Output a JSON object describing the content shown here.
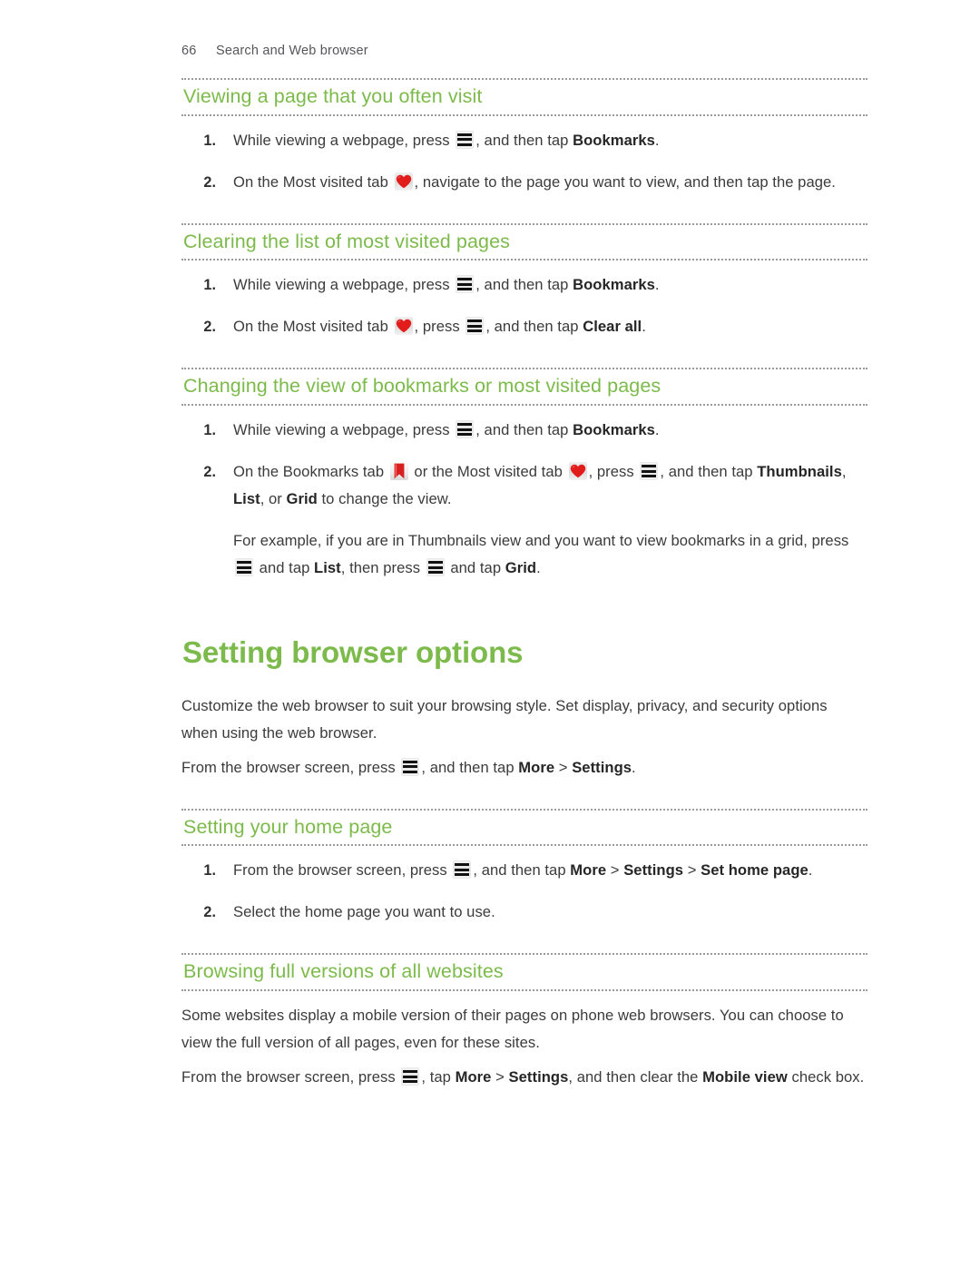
{
  "page": {
    "number": "66",
    "running_head": "Search and Web browser",
    "heading_color": "#7cbb4b",
    "body_color": "#3b3b3b"
  },
  "icons": {
    "menu": "menu-bars-icon",
    "most_visited": "heart-icon",
    "bookmarks": "bookmark-ribbon-icon"
  },
  "sections": {
    "viewing_page": {
      "heading": "Viewing a page that you often visit",
      "steps": [
        {
          "num": "1.",
          "parts": [
            {
              "t": "text",
              "v": "While viewing a webpage, press "
            },
            {
              "t": "icon",
              "v": "menu"
            },
            {
              "t": "text",
              "v": ", and then tap "
            },
            {
              "t": "bold",
              "v": "Bookmarks"
            },
            {
              "t": "text",
              "v": "."
            }
          ]
        },
        {
          "num": "2.",
          "parts": [
            {
              "t": "text",
              "v": "On the Most visited tab "
            },
            {
              "t": "icon",
              "v": "most_visited"
            },
            {
              "t": "text",
              "v": ", navigate to the page you want to view, and then tap the page."
            }
          ]
        }
      ]
    },
    "clearing_list": {
      "heading": "Clearing the list of most visited pages",
      "steps": [
        {
          "num": "1.",
          "parts": [
            {
              "t": "text",
              "v": "While viewing a webpage, press "
            },
            {
              "t": "icon",
              "v": "menu"
            },
            {
              "t": "text",
              "v": ", and then tap "
            },
            {
              "t": "bold",
              "v": "Bookmarks"
            },
            {
              "t": "text",
              "v": "."
            }
          ]
        },
        {
          "num": "2.",
          "parts": [
            {
              "t": "text",
              "v": "On the Most visited tab "
            },
            {
              "t": "icon",
              "v": "most_visited"
            },
            {
              "t": "text",
              "v": ", press "
            },
            {
              "t": "icon",
              "v": "menu"
            },
            {
              "t": "text",
              "v": ", and then tap "
            },
            {
              "t": "bold",
              "v": "Clear all"
            },
            {
              "t": "text",
              "v": "."
            }
          ]
        }
      ]
    },
    "changing_view": {
      "heading": "Changing the view of bookmarks or most visited pages",
      "steps": [
        {
          "num": "1.",
          "parts": [
            {
              "t": "text",
              "v": "While viewing a webpage, press "
            },
            {
              "t": "icon",
              "v": "menu"
            },
            {
              "t": "text",
              "v": ", and then tap "
            },
            {
              "t": "bold",
              "v": "Bookmarks"
            },
            {
              "t": "text",
              "v": "."
            }
          ]
        },
        {
          "num": "2.",
          "parts": [
            {
              "t": "text",
              "v": "On the Bookmarks tab "
            },
            {
              "t": "icon",
              "v": "bookmarks"
            },
            {
              "t": "text",
              "v": " or the Most visited tab "
            },
            {
              "t": "icon",
              "v": "most_visited"
            },
            {
              "t": "text",
              "v": ", press "
            },
            {
              "t": "icon",
              "v": "menu"
            },
            {
              "t": "text",
              "v": ", and then tap "
            },
            {
              "t": "bold",
              "v": "Thumbnails"
            },
            {
              "t": "text",
              "v": ", "
            },
            {
              "t": "bold",
              "v": "List"
            },
            {
              "t": "text",
              "v": ", or "
            },
            {
              "t": "bold",
              "v": "Grid"
            },
            {
              "t": "text",
              "v": " to change the view."
            }
          ],
          "sub_parts": [
            {
              "t": "text",
              "v": "For example, if you are in Thumbnails view and you want to view bookmarks in a grid, press "
            },
            {
              "t": "icon",
              "v": "menu"
            },
            {
              "t": "text",
              "v": " and tap "
            },
            {
              "t": "bold",
              "v": "List"
            },
            {
              "t": "text",
              "v": ", then press "
            },
            {
              "t": "icon",
              "v": "menu"
            },
            {
              "t": "text",
              "v": " and tap "
            },
            {
              "t": "bold",
              "v": "Grid"
            },
            {
              "t": "text",
              "v": "."
            }
          ]
        }
      ]
    },
    "setting_browser_options": {
      "heading": "Setting browser options",
      "intro_parts": [
        {
          "t": "text",
          "v": "Customize the web browser to suit your browsing style. Set display, privacy, and security options when using the web browser."
        }
      ],
      "instruction_parts": [
        {
          "t": "text",
          "v": "From the browser screen, press "
        },
        {
          "t": "icon",
          "v": "menu"
        },
        {
          "t": "text",
          "v": ", and then tap "
        },
        {
          "t": "bold",
          "v": "More"
        },
        {
          "t": "text",
          "v": " > "
        },
        {
          "t": "bold",
          "v": "Settings"
        },
        {
          "t": "text",
          "v": "."
        }
      ]
    },
    "setting_home_page": {
      "heading": "Setting your home page",
      "steps": [
        {
          "num": "1.",
          "parts": [
            {
              "t": "text",
              "v": "From the browser screen, press "
            },
            {
              "t": "icon",
              "v": "menu"
            },
            {
              "t": "text",
              "v": ", and then tap "
            },
            {
              "t": "bold",
              "v": "More"
            },
            {
              "t": "text",
              "v": " > "
            },
            {
              "t": "bold",
              "v": "Settings"
            },
            {
              "t": "text",
              "v": " > "
            },
            {
              "t": "bold",
              "v": "Set home page"
            },
            {
              "t": "text",
              "v": "."
            }
          ]
        },
        {
          "num": "2.",
          "parts": [
            {
              "t": "text",
              "v": "Select the home page you want to use."
            }
          ]
        }
      ]
    },
    "browsing_full_versions": {
      "heading": "Browsing full versions of all websites",
      "intro_parts": [
        {
          "t": "text",
          "v": "Some websites display a mobile version of their pages on phone web browsers. You can choose to view the full version of all pages, even for these sites."
        }
      ],
      "instruction_parts": [
        {
          "t": "text",
          "v": "From the browser screen, press "
        },
        {
          "t": "icon",
          "v": "menu"
        },
        {
          "t": "text",
          "v": ", tap "
        },
        {
          "t": "bold",
          "v": "More"
        },
        {
          "t": "text",
          "v": " > "
        },
        {
          "t": "bold",
          "v": "Settings"
        },
        {
          "t": "text",
          "v": ", and then clear the "
        },
        {
          "t": "bold",
          "v": "Mobile view"
        },
        {
          "t": "text",
          "v": " check box."
        }
      ]
    }
  }
}
